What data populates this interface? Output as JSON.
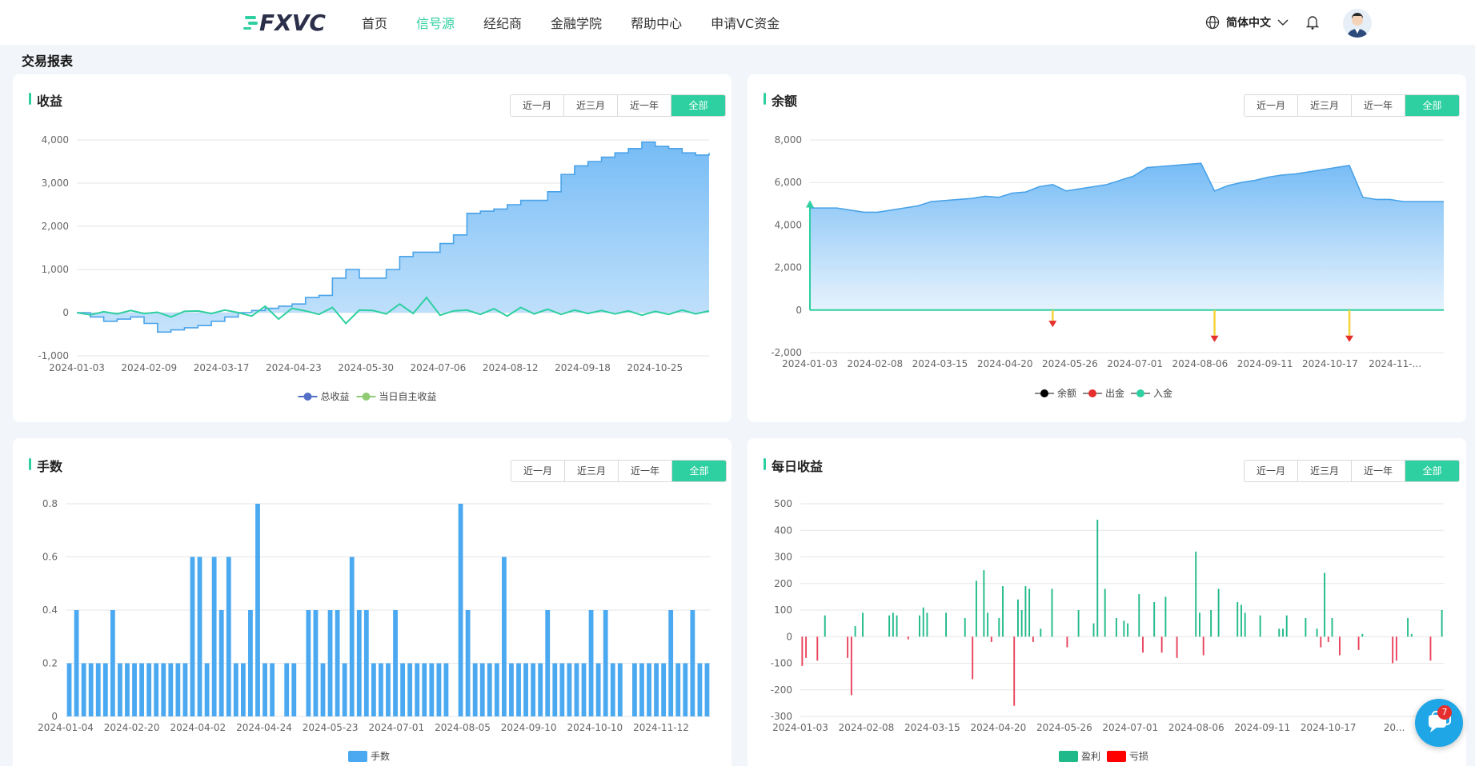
{
  "nav": {
    "logo_text": "FXVC",
    "items": [
      "首页",
      "信号源",
      "经纪商",
      "金融学院",
      "帮助中心",
      "申请VC资金"
    ],
    "active_index": 1,
    "language": "简体中文",
    "chat_badge": "7"
  },
  "page_title": "交易报表",
  "range_buttons": [
    "近一月",
    "近三月",
    "近一年",
    "全部"
  ],
  "active_range_index": 3,
  "accent_color": "#2ecfa0",
  "chart_data": [
    {
      "id": "profit",
      "title": "收益",
      "type": "area",
      "ylim": [
        -1000,
        4000
      ],
      "y_ticks": [
        -1000,
        0,
        1000,
        2000,
        3000,
        4000
      ],
      "y_tick_labels": [
        "-1,000",
        "0",
        "1,000",
        "2,000",
        "3,000",
        "4,000"
      ],
      "x_tick_labels": [
        "2024-01-03",
        "2024-02-09",
        "2024-03-17",
        "2024-04-23",
        "2024-05-30",
        "2024-07-06",
        "2024-08-12",
        "2024-09-18",
        "2024-10-25"
      ],
      "legend": [
        "总收益",
        "当日自主收益"
      ],
      "legend_placement": "bottom",
      "series": [
        {
          "name": "总收益",
          "color": "#4aa3e8",
          "values": [
            0,
            -100,
            -200,
            -150,
            -100,
            -250,
            -450,
            -400,
            -350,
            -300,
            -200,
            -100,
            0,
            50,
            100,
            150,
            200,
            350,
            400,
            800,
            1000,
            800,
            800,
            1000,
            1300,
            1400,
            1400,
            1600,
            1800,
            2300,
            2350,
            2400,
            2500,
            2600,
            2600,
            2800,
            3200,
            3400,
            3500,
            3600,
            3700,
            3800,
            3950,
            3850,
            3800,
            3700,
            3650,
            3700
          ]
        },
        {
          "name": "当日自主收益",
          "color": "#2ecfa0",
          "values": [
            0,
            -50,
            20,
            -30,
            50,
            -20,
            10,
            -100,
            30,
            40,
            -20,
            60,
            0,
            -80,
            150,
            -150,
            100,
            40,
            -40,
            120,
            -250,
            60,
            50,
            -30,
            200,
            -20,
            350,
            -60,
            40,
            60,
            -40,
            90,
            -80,
            120,
            -30,
            80,
            -40,
            60,
            -20,
            50,
            -30,
            40,
            -60,
            30,
            -40,
            60,
            -30,
            40
          ]
        }
      ]
    },
    {
      "id": "balance",
      "title": "余额",
      "type": "area",
      "ylim": [
        -2000,
        8000
      ],
      "y_ticks": [
        -2000,
        0,
        2000,
        4000,
        6000,
        8000
      ],
      "y_tick_labels": [
        "-2,000",
        "0",
        "2,000",
        "4,000",
        "6,000",
        "8,000"
      ],
      "x_tick_labels": [
        "2024-01-03",
        "2024-02-08",
        "2024-03-15",
        "2024-04-20",
        "2024-05-26",
        "2024-07-01",
        "2024-08-06",
        "2024-09-11",
        "2024-10-17",
        "2024-11-..."
      ],
      "legend": [
        "余额",
        "出金",
        "入金"
      ],
      "legend_placement": "bottom",
      "series": [
        {
          "name": "余额",
          "color": "#4aa3e8",
          "values": [
            4800,
            4800,
            4800,
            4700,
            4600,
            4600,
            4700,
            4800,
            4900,
            5100,
            5150,
            5200,
            5250,
            5350,
            5300,
            5500,
            5550,
            5800,
            5900,
            5600,
            5700,
            5800,
            5900,
            6100,
            6300,
            6700,
            6750,
            6800,
            6850,
            6900,
            5600,
            5850,
            6000,
            6100,
            6250,
            6350,
            6400,
            6500,
            6600,
            6700,
            6800,
            5300,
            5200,
            5200,
            5100,
            5100,
            5100,
            5100
          ]
        },
        {
          "name": "出金",
          "color": "#e52f2f",
          "events": [
            {
              "x_index": 18,
              "value": -500
            },
            {
              "x_index": 30,
              "value": -1200
            },
            {
              "x_index": 40,
              "value": -1200
            }
          ]
        },
        {
          "name": "入金",
          "color": "#2ecfa0",
          "events": [
            {
              "x_index": 0,
              "value": 4900
            }
          ]
        }
      ]
    },
    {
      "id": "lots",
      "title": "手数",
      "type": "bar",
      "ylim": [
        0,
        0.8
      ],
      "y_ticks": [
        0,
        0.2,
        0.4,
        0.6,
        0.8
      ],
      "y_tick_labels": [
        "0",
        "0.2",
        "0.4",
        "0.6",
        "0.8"
      ],
      "x_tick_labels": [
        "2024-01-04",
        "2024-02-20",
        "2024-04-02",
        "2024-04-24",
        "2024-05-23",
        "2024-07-01",
        "2024-08-05",
        "2024-09-10",
        "2024-10-10",
        "2024-11-12"
      ],
      "legend": [
        "手数"
      ],
      "legend_placement": "bottom",
      "series": [
        {
          "name": "手数",
          "color": "#4aa9f0",
          "values": [
            0.2,
            0.4,
            0.2,
            0.2,
            0.2,
            0.2,
            0.4,
            0.2,
            0.2,
            0.2,
            0.2,
            0.2,
            0.2,
            0.2,
            0.2,
            0.2,
            0.2,
            0.6,
            0.6,
            0.2,
            0.6,
            0.4,
            0.6,
            0.2,
            0.2,
            0.4,
            0.8,
            0.2,
            0.2,
            0,
            0.2,
            0.2,
            0,
            0.4,
            0.4,
            0.2,
            0.4,
            0.4,
            0.2,
            0.6,
            0.4,
            0.4,
            0.2,
            0.2,
            0.2,
            0.4,
            0.2,
            0.2,
            0.2,
            0.2,
            0.2,
            0.2,
            0.2,
            0,
            0.8,
            0.4,
            0.2,
            0.2,
            0.2,
            0.2,
            0.6,
            0.2,
            0.2,
            0.2,
            0.2,
            0.2,
            0.4,
            0.2,
            0.2,
            0.2,
            0.2,
            0.2,
            0.4,
            0.2,
            0.4,
            0.2,
            0.2,
            0,
            0.2,
            0.2,
            0.2,
            0.2,
            0.2,
            0.4,
            0.2,
            0.2,
            0.4,
            0.2,
            0.2
          ]
        }
      ]
    },
    {
      "id": "daily",
      "title": "每日收益",
      "type": "bar",
      "ylim": [
        -300,
        500
      ],
      "y_ticks": [
        -300,
        -200,
        -100,
        0,
        100,
        200,
        300,
        400,
        500
      ],
      "y_tick_labels": [
        "-300",
        "-200",
        "-100",
        "0",
        "100",
        "200",
        "300",
        "400",
        "500"
      ],
      "x_tick_labels": [
        "2024-01-03",
        "2024-02-08",
        "2024-03-15",
        "2024-04-20",
        "2024-05-26",
        "2024-07-01",
        "2024-08-06",
        "2024-09-11",
        "2024-10-17",
        "20..."
      ],
      "legend": [
        "盈利",
        "亏损"
      ],
      "legend_placement": "bottom",
      "series": [
        {
          "name": "每日收益",
          "positive_color": "#20b98a",
          "negative_color": "#e8425b",
          "values": [
            -110,
            -80,
            0,
            0,
            -90,
            0,
            80,
            0,
            0,
            0,
            0,
            0,
            -80,
            -220,
            40,
            0,
            90,
            0,
            0,
            0,
            0,
            0,
            0,
            80,
            90,
            80,
            0,
            0,
            -10,
            0,
            0,
            80,
            110,
            90,
            0,
            0,
            0,
            0,
            90,
            0,
            0,
            0,
            0,
            70,
            0,
            -160,
            210,
            0,
            250,
            90,
            -20,
            0,
            70,
            190,
            0,
            0,
            -260,
            140,
            100,
            190,
            180,
            -20,
            0,
            30,
            0,
            0,
            180,
            0,
            0,
            0,
            -40,
            0,
            0,
            100,
            0,
            0,
            0,
            50,
            440,
            0,
            180,
            0,
            0,
            70,
            0,
            60,
            50,
            0,
            0,
            160,
            -60,
            0,
            0,
            130,
            0,
            -60,
            150,
            0,
            0,
            -80,
            0,
            0,
            0,
            0,
            320,
            90,
            -70,
            0,
            100,
            0,
            180,
            0,
            0,
            0,
            0,
            130,
            120,
            90,
            0,
            0,
            0,
            80,
            0,
            0,
            0,
            0,
            30,
            30,
            80,
            0,
            0,
            0,
            0,
            70,
            0,
            0,
            30,
            -40,
            240,
            -20,
            70,
            0,
            -70,
            0,
            0,
            0,
            0,
            -50,
            10,
            0,
            0,
            0,
            0,
            0,
            0,
            0,
            -100,
            -90,
            0,
            0,
            70,
            10,
            0,
            0,
            0,
            0,
            -90,
            0,
            0,
            100
          ]
        }
      ]
    }
  ]
}
